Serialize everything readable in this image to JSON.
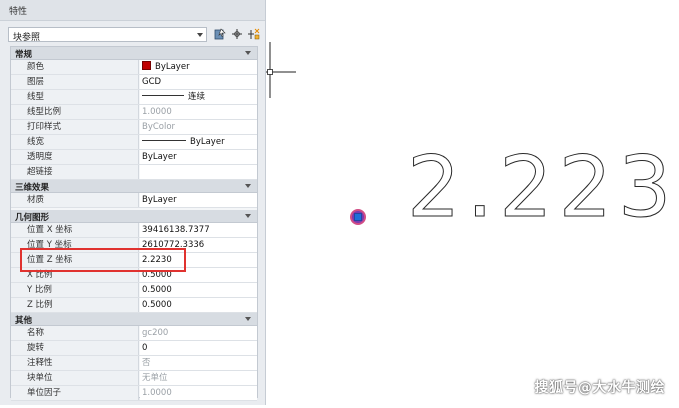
{
  "palette": {
    "title": "特性",
    "selector": "块参照",
    "toolbar": {
      "select_objects_icon": "select-objects-icon",
      "quick_select_icon": "quick-select-icon",
      "toggle_pickadd_icon": "pickadd-icon"
    },
    "sections": {
      "general": {
        "title": "常规",
        "rows": [
          {
            "label": "颜色",
            "value": "ByLayer"
          },
          {
            "label": "图层",
            "value": "GCD"
          },
          {
            "label": "线型",
            "value": "连续"
          },
          {
            "label": "线型比例",
            "value": "1.0000"
          },
          {
            "label": "打印样式",
            "value": "ByColor"
          },
          {
            "label": "线宽",
            "value": "ByLayer"
          },
          {
            "label": "透明度",
            "value": "ByLayer"
          },
          {
            "label": "超链接",
            "value": ""
          }
        ]
      },
      "3d": {
        "title": "三维效果",
        "rows": [
          {
            "label": "材质",
            "value": "ByLayer"
          }
        ]
      },
      "geometry": {
        "title": "几何图形",
        "rows": [
          {
            "label": "位置 X 坐标",
            "value": "39416138.7377"
          },
          {
            "label": "位置 Y 坐标",
            "value": "2610772.3336"
          },
          {
            "label": "位置 Z 坐标",
            "value": "2.2230"
          },
          {
            "label": "X 比例",
            "value": "0.5000"
          },
          {
            "label": "Y 比例",
            "value": "0.5000"
          },
          {
            "label": "Z 比例",
            "value": "0.5000"
          }
        ]
      },
      "misc": {
        "title": "其他",
        "rows": [
          {
            "label": "名称",
            "value": "gc200"
          },
          {
            "label": "旋转",
            "value": "0"
          },
          {
            "label": "注释性",
            "value": "否"
          },
          {
            "label": "块单位",
            "value": "无单位"
          },
          {
            "label": "单位因子",
            "value": "1.0000"
          }
        ]
      }
    }
  },
  "drawing": {
    "elevation_text": "2.223"
  },
  "watermark": "搜狐号@大水牛测绘",
  "colors": {
    "color_swatch": "#c00000",
    "highlight_box": "#e0322f",
    "insertion_marker_outer": "#cc3366",
    "insertion_marker_inner": "#1e6fd9"
  }
}
